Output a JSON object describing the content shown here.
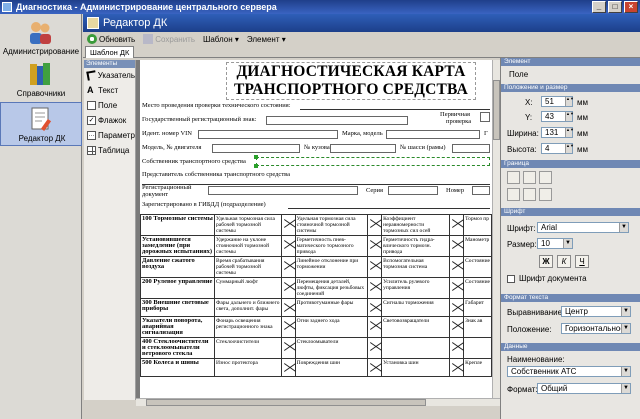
{
  "window": {
    "title": "Диагностика - Администрирование центрального сервера"
  },
  "nav": {
    "items": [
      {
        "label": "Администрирование"
      },
      {
        "label": "Справочники"
      },
      {
        "label": "Редактор ДК"
      }
    ]
  },
  "header": {
    "title": "Редактор ДК"
  },
  "toolbar": {
    "refresh": "Обновить",
    "save": "Сохранить",
    "template": "Шаблон ▾",
    "element": "Элемент ▾"
  },
  "tabs": {
    "template_tab": "Шаблон ДК"
  },
  "elements": {
    "header": "Элементы",
    "pointer": "Указатель",
    "text": "Текст",
    "field": "Поле",
    "flag": "Флажок",
    "parameter": "Параметр",
    "table": "Таблица"
  },
  "doc": {
    "title_line1": "ДИАГНОСТИЧЕСКАЯ КАРТА",
    "title_line2": "ТРАНСПОРТНОГО СРЕДСТВА",
    "f_place": "Место проведения проверки технического состояния:",
    "f_reg": "Государственный регистрационный знак:",
    "f_primary": "Первичная",
    "f_check": "проверка",
    "f_vin": "Идент. номер VIN",
    "f_make": "Марка, модель",
    "f_year": "Г",
    "f_engine": "Модель, № двигателя",
    "f_body": "№ кузова",
    "f_chassis": "№ шасси (рамы)",
    "f_owner": "Собственник транспортного средства",
    "f_rep": "Представитель собственника транспортного средства",
    "f_regdoc": "Регистрационный документ",
    "f_series": "Серия",
    "f_num": "Номер",
    "f_gibdd": "Зарегистрировано в ГИБДД (подразделение)",
    "rows": [
      {
        "sec": "100 Тормозные системы",
        "c1": "Удельная тормозная сила рабочей тормозной системы",
        "c2": "Удельная тормозная сила стояночной тормозной системы",
        "c3": "Коэффициент неравномерности тормозных сил осей",
        "c4": "Тормоз пр"
      },
      {
        "sec": "Установившееся замедление (при дорожных испытаниях)",
        "c1": "Удержание на уклоне стояночной тормозной системы",
        "c2": "Герметичность пнев-матического тормозного привода",
        "c3": "Герметичность гидра-влического тормозн. привода",
        "c4": "Манометр"
      },
      {
        "sec": "Давление сжатого воздуха",
        "c1": "Время срабатывания рабочей тормозной системы",
        "c2": "Линейное отклонение при торможении",
        "c3": "Вспомогательная тормозная система",
        "c4": "Состояние"
      },
      {
        "sec": "200 Рулевое управление",
        "c1": "Суммарный люфт",
        "c2": "Перемещения деталей, люфты, фиксация резьбовых соединений",
        "c3": "Усилитель рулевого управления",
        "c4": "Состояние"
      },
      {
        "sec": "300 Внешние световые приборы",
        "c1": "Фары дальнего и ближнего света, дополнит. фары",
        "c2": "Противотуманные фары",
        "c3": "Сигналы торможения",
        "c4": "Габарит"
      },
      {
        "sec": "Указатели поворота, аварийная сигнализация",
        "c1": "Фонарь освещения регистрационного знака",
        "c2": "Огни заднего хода",
        "c3": "Световозвращатели",
        "c4": "Знак ав"
      },
      {
        "sec": "400 Стеклоочистители и стеклоомыватели ветрового стекла",
        "c1": "Стеклоочистители",
        "c2": "Стеклоомыватели",
        "c3": "",
        "c4": ""
      },
      {
        "sec": "500 Колеса и шины",
        "c1": "Износ протектора",
        "c2": "Повреждения шин",
        "c3": "Установка шин",
        "c4": "Крепле"
      }
    ]
  },
  "props": {
    "header": "Элемент",
    "element_name": "Поле",
    "pos_section": "Положение и размер",
    "x_label": "X:",
    "x_value": "51",
    "y_label": "Y:",
    "y_value": "43",
    "w_label": "Ширина:",
    "w_value": "131",
    "h_label": "Высота:",
    "h_value": "4",
    "unit": "мм",
    "border_section": "Граница",
    "font_section": "Шрифт",
    "font_label": "Шрифт:",
    "font_value": "Arial",
    "size_label": "Размер:",
    "size_value": "10",
    "bold": "Ж",
    "italic": "К",
    "underline": "Ч",
    "doc_font": "Шрифт документа",
    "textfmt_section": "Формат текста",
    "align_label": "Выравнивание:",
    "align_value": "Центр",
    "position_label": "Положение:",
    "position_value": "Горизонтальное",
    "data_section": "Данные",
    "name_label": "Наименование:",
    "name_value": "Собственник АТС",
    "format_label": "Формат:",
    "format_value": "Общий"
  }
}
